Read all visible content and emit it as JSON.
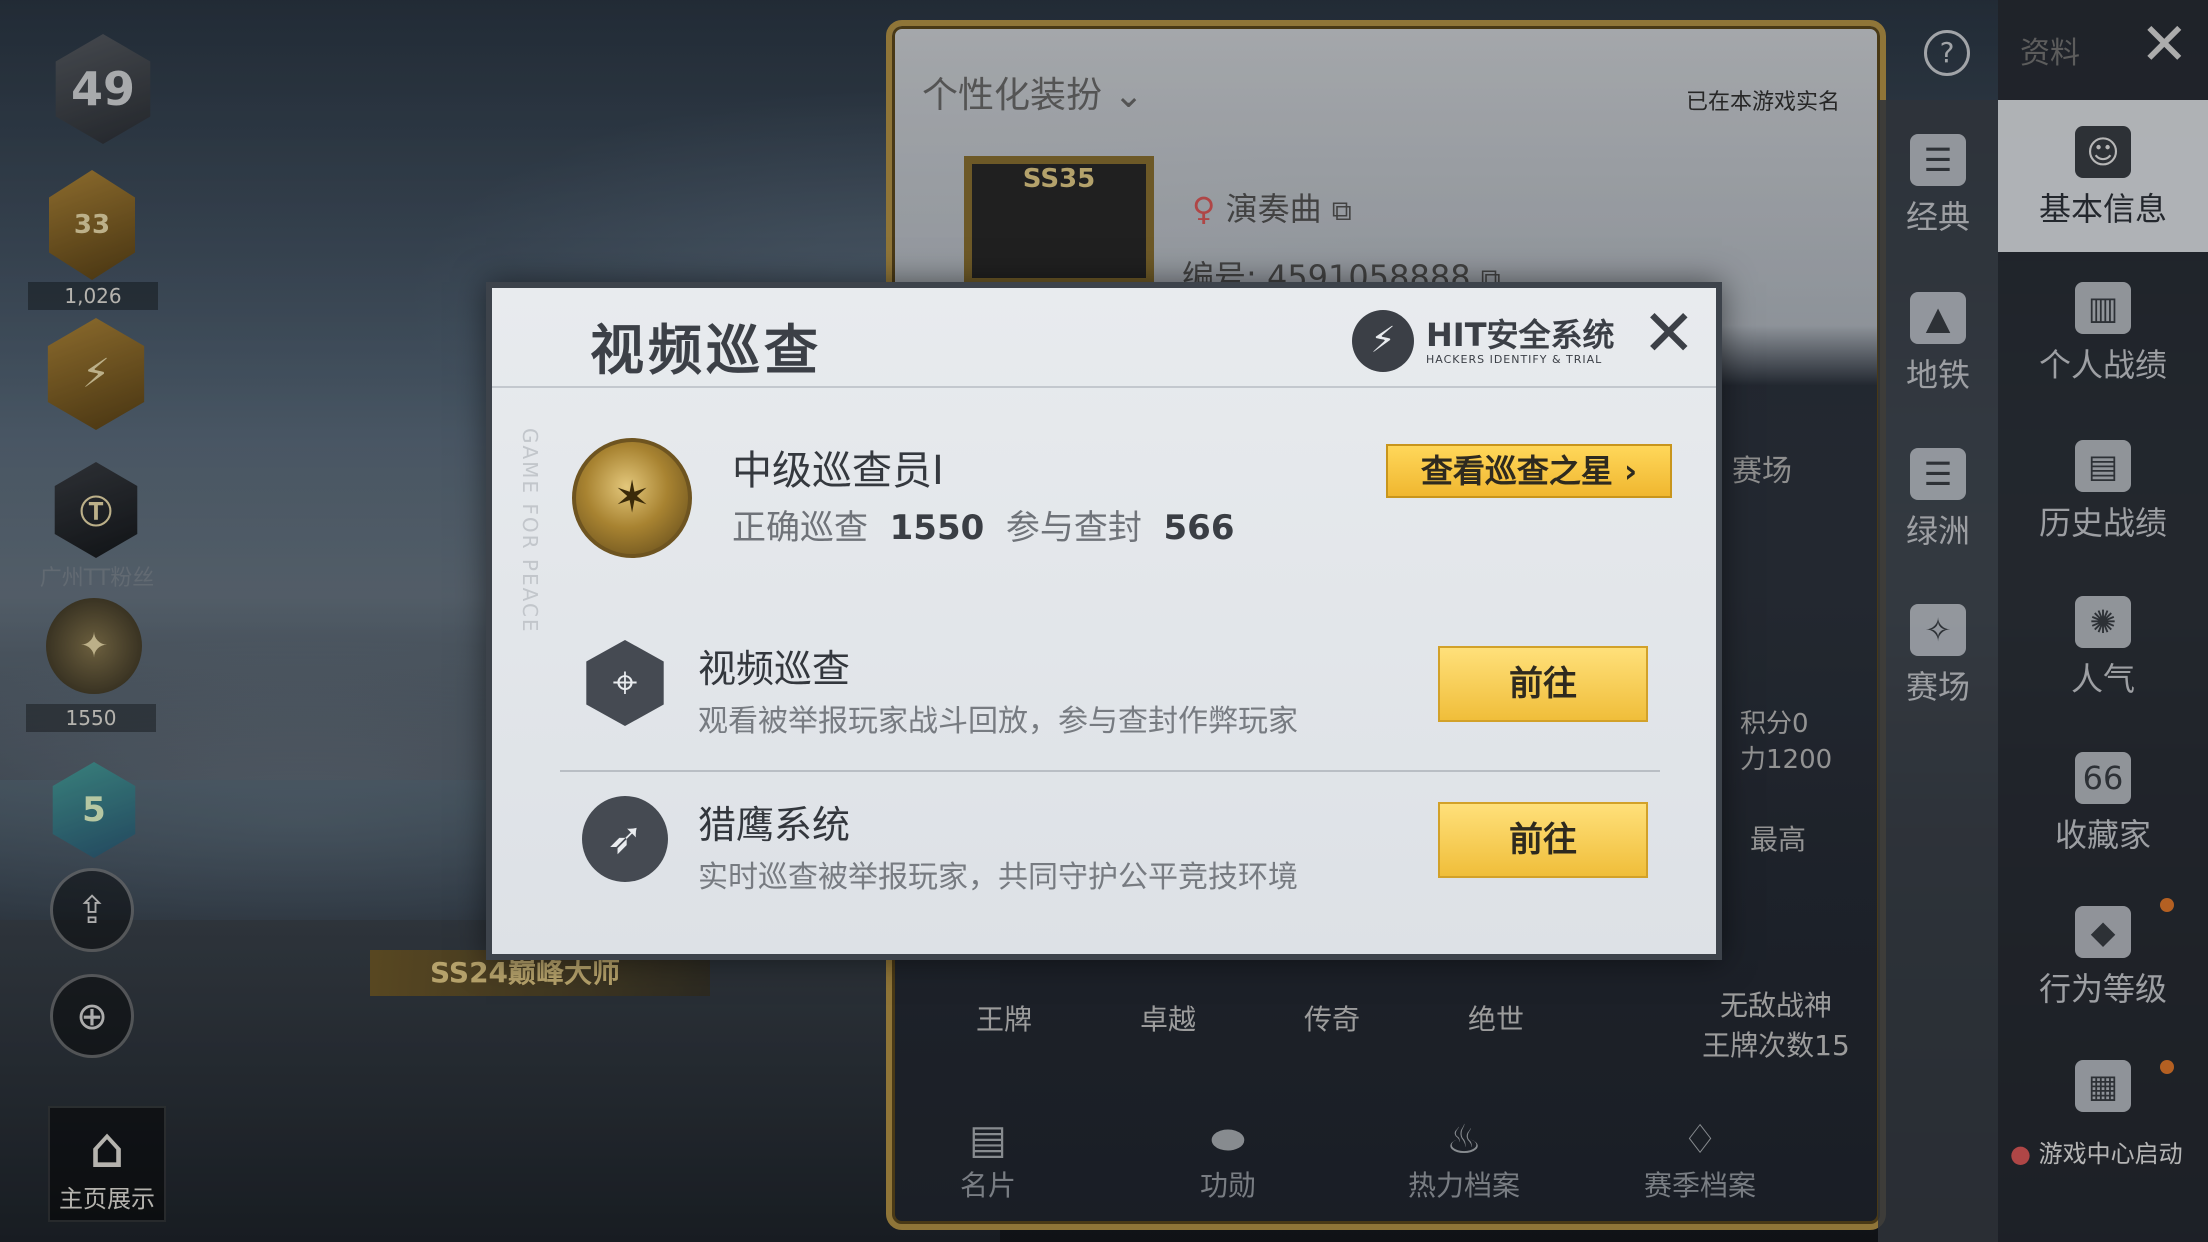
{
  "left_column": {
    "level": "49",
    "fire_badge_value": "33",
    "fire_badge_caption": "1,026",
    "fans_caption": "广州TT粉丝",
    "patrol_badge_caption": "1550",
    "tier_badge_value": "5",
    "share_icon": "share-icon",
    "zoom_icon": "zoom-in-icon",
    "home_label": "主页展示"
  },
  "profile": {
    "custom_label": "个性化装扮",
    "real_name_note": "已在本游戏实名",
    "frame_label": "SS35",
    "nickname": "演奏曲",
    "uid": "编号: 4591058888",
    "season_banner": "SS24巅峰大师",
    "peek_text": "赛场",
    "peek_score": "积分0",
    "peek_power": "力1200",
    "peek_high": "最高",
    "rank_labels": [
      "王牌",
      "卓越",
      "传奇",
      "绝世"
    ],
    "rank_info_1": "无敌战神",
    "rank_info_2": "王牌次数15",
    "bottom_tabs": [
      {
        "label": "名片",
        "icon": "card-icon"
      },
      {
        "label": "功勋",
        "icon": "medal-icon"
      },
      {
        "label": "热力档案",
        "icon": "fire-icon"
      },
      {
        "label": "赛季档案",
        "icon": "season-icon"
      }
    ]
  },
  "topbar": {
    "info_label": "资料"
  },
  "nav_mid": [
    {
      "label": "经典",
      "icon": "classic-icon"
    },
    {
      "label": "地铁",
      "icon": "metro-icon"
    },
    {
      "label": "绿洲",
      "icon": "oasis-icon"
    },
    {
      "label": "赛场",
      "icon": "arena-icon"
    }
  ],
  "nav_right": [
    {
      "label": "基本信息",
      "icon": "basic-info-icon",
      "active": true
    },
    {
      "label": "个人战绩",
      "icon": "stats-icon"
    },
    {
      "label": "历史战绩",
      "icon": "history-icon"
    },
    {
      "label": "人气",
      "icon": "popularity-icon"
    },
    {
      "label": "收藏家",
      "icon": "collector-icon"
    },
    {
      "label": "行为等级",
      "icon": "behavior-icon"
    }
  ],
  "game_center_launch": "游戏中心启动",
  "modal": {
    "title": "视频巡查",
    "logo_main": "HIT安全系统",
    "logo_sub": "HACKERS IDENTIFY & TRIAL",
    "watermark": "GAME FOR PEACE",
    "rank_title": "中级巡查员I",
    "stats_label_1": "正确巡查",
    "stats_value_1": "1550",
    "stats_label_2": "参与查封",
    "stats_value_2": "566",
    "star_button": "查看巡查之星 ›",
    "rows": [
      {
        "title": "视频巡查",
        "desc": "观看被举报玩家战斗回放，参与查封作弊玩家",
        "button": "前往",
        "icon": "crosshair-icon"
      },
      {
        "title": "猎鹰系统",
        "desc": "实时巡查被举报玩家，共同守护公平竞技环境",
        "button": "前往",
        "icon": "eagle-icon"
      }
    ]
  },
  "colors": {
    "accent_gold": "#f0be3a",
    "frame_gold": "#b89648",
    "modal_bg": "#e8ebee"
  }
}
